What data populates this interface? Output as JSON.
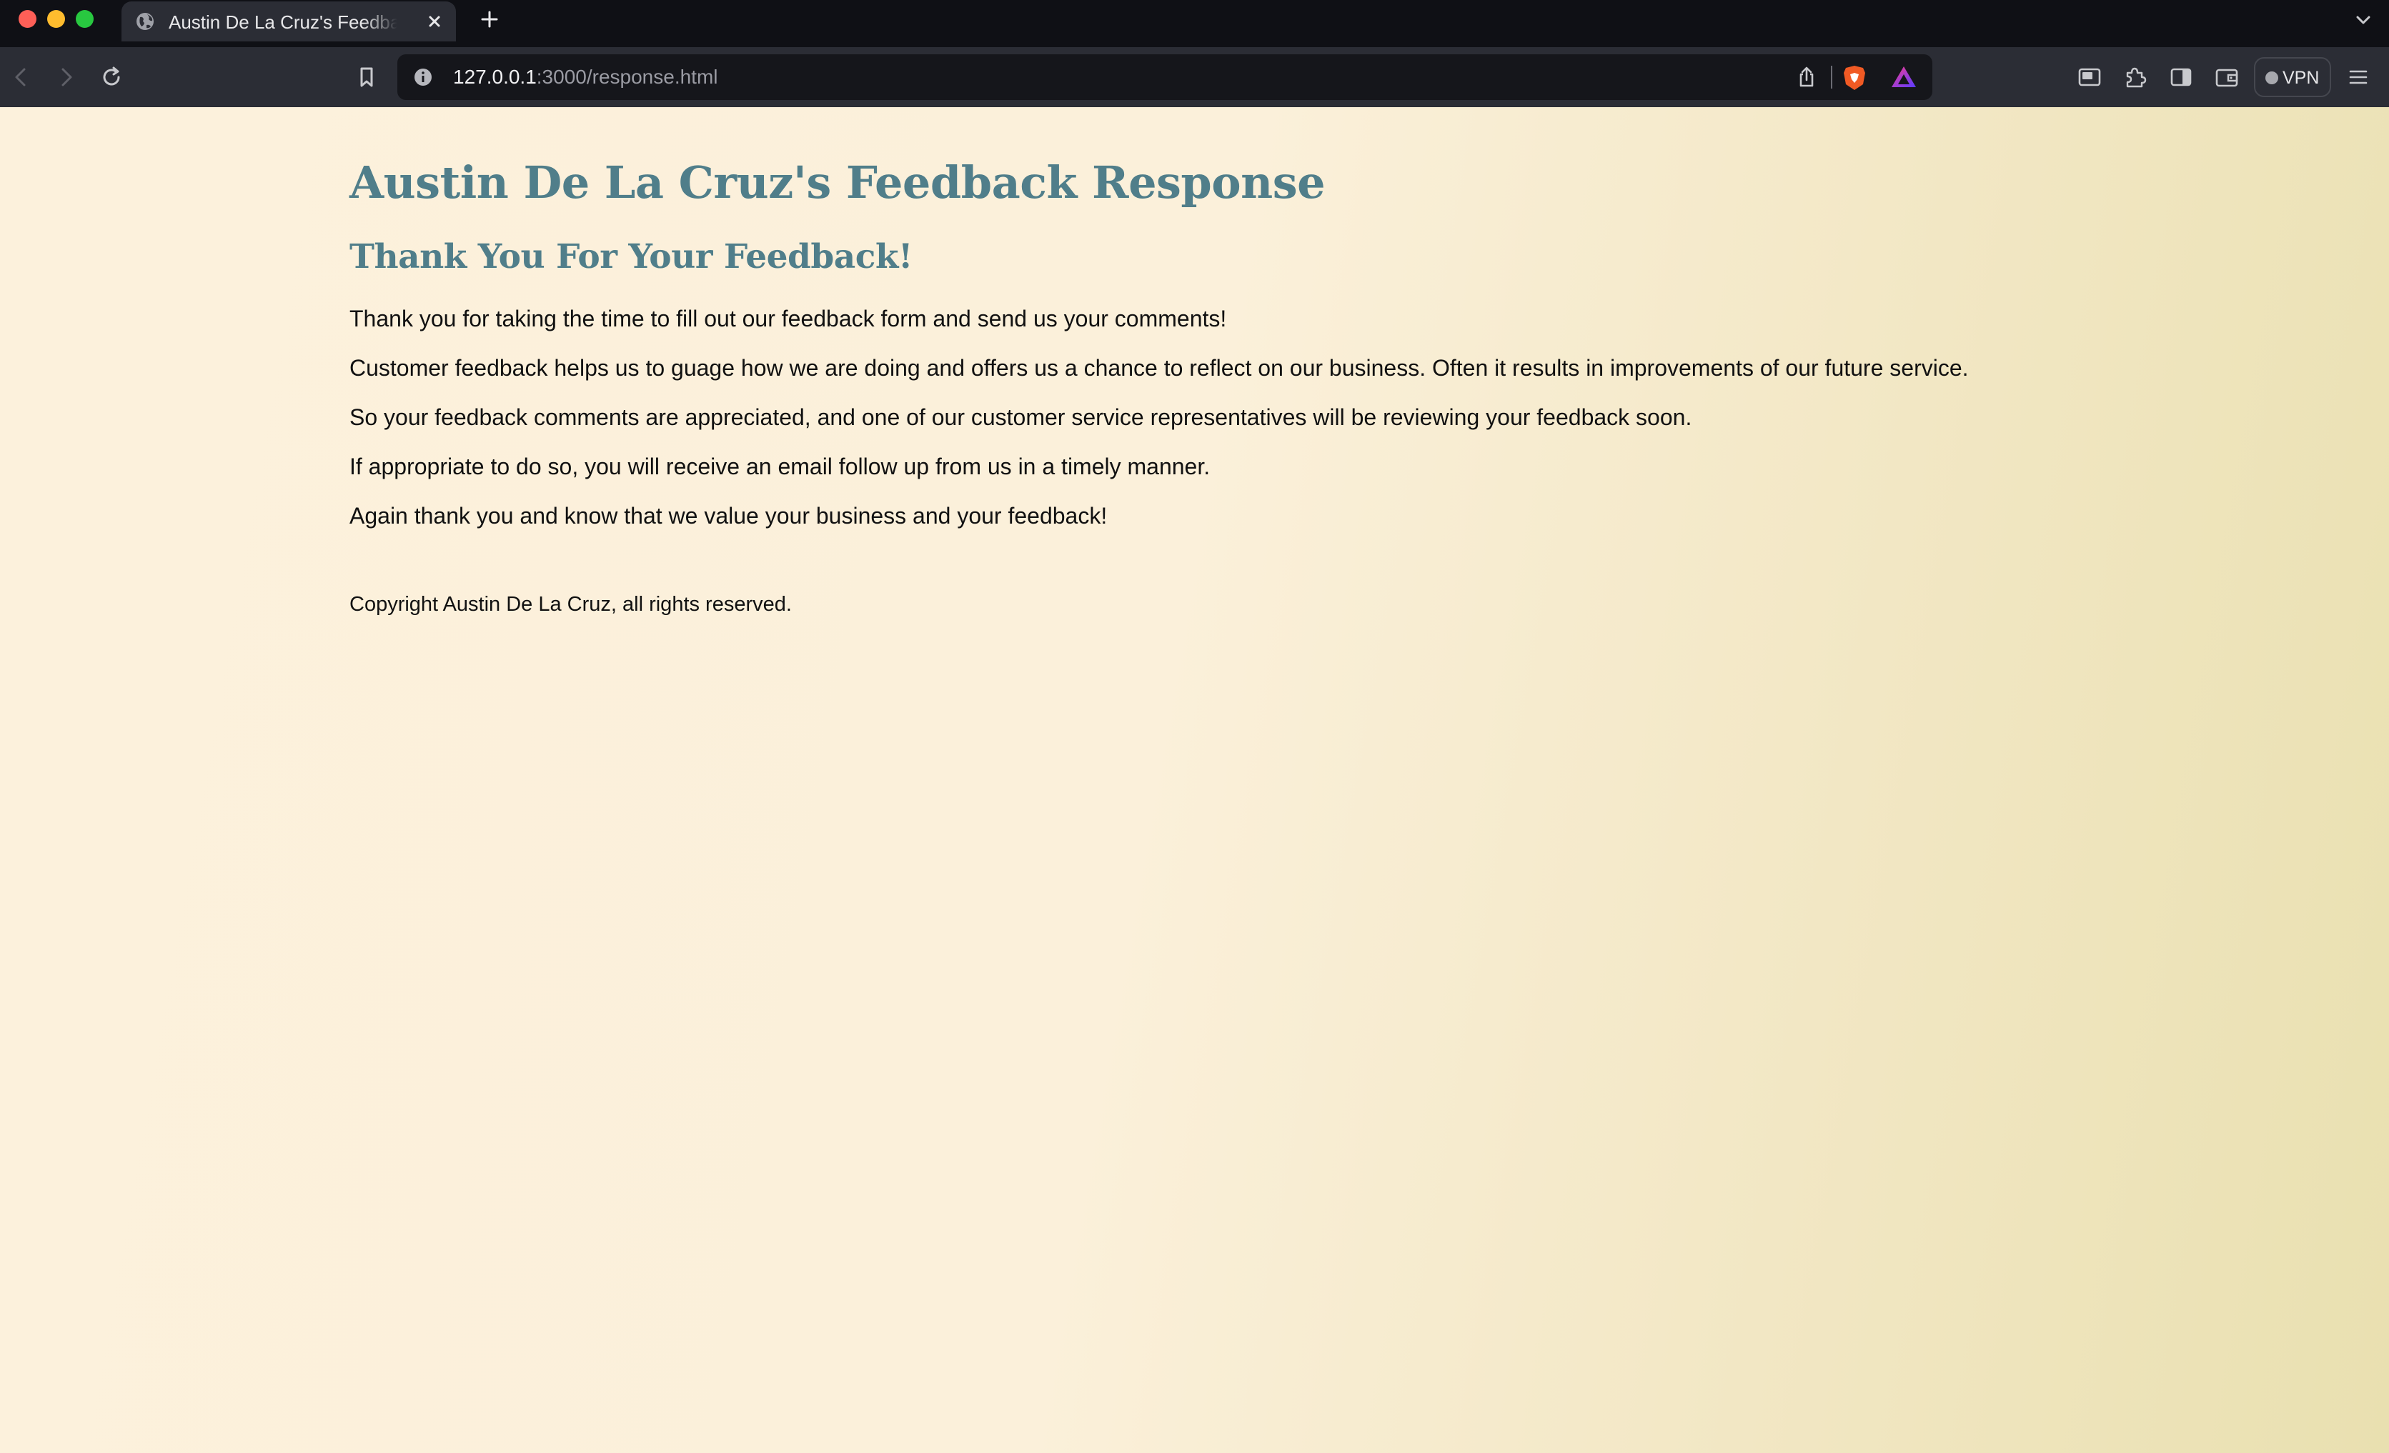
{
  "browser": {
    "tab_title": "Austin De La Cruz's Feedback Response",
    "url_host": "127.0.0.1",
    "url_rest": ":3000/response.html",
    "vpn_label": "VPN"
  },
  "page": {
    "title": "Austin De La Cruz's Feedback Response",
    "subtitle": "Thank You For Your Feedback!",
    "paragraphs": [
      "Thank you for taking the time to fill out our feedback form and send us your comments!",
      "Customer feedback helps us to guage how we are doing and offers us a chance to reflect on our business. Often it results in improvements of our future service.",
      "So your feedback comments are appreciated, and one of our customer service representatives will be reviewing your feedback soon.",
      "If appropriate to do so, you will receive an email follow up from us in a timely manner.",
      "Again thank you and know that we value your business and your feedback!"
    ],
    "footer": "Copyright Austin De La Cruz, all rights reserved."
  },
  "colors": {
    "heading": "#507e8a",
    "chrome_dark": "#0f1015",
    "chrome_toolbar": "#2b2d35"
  },
  "icons": {
    "tab_favicon": "globe-icon",
    "tab_close": "close-icon",
    "new_tab": "plus-icon",
    "back": "back-arrow-icon",
    "forward": "forward-arrow-icon",
    "reload": "reload-icon",
    "bookmark": "bookmark-icon",
    "site_info": "info-icon",
    "share": "share-icon",
    "brave_shields": "brave-shield-icon",
    "rewards": "rewards-triangle-icon",
    "picture_in_picture": "pip-icon",
    "extensions": "puzzle-icon",
    "sidebar": "sidebar-icon",
    "wallet": "wallet-icon",
    "menu": "hamburger-menu-icon"
  }
}
